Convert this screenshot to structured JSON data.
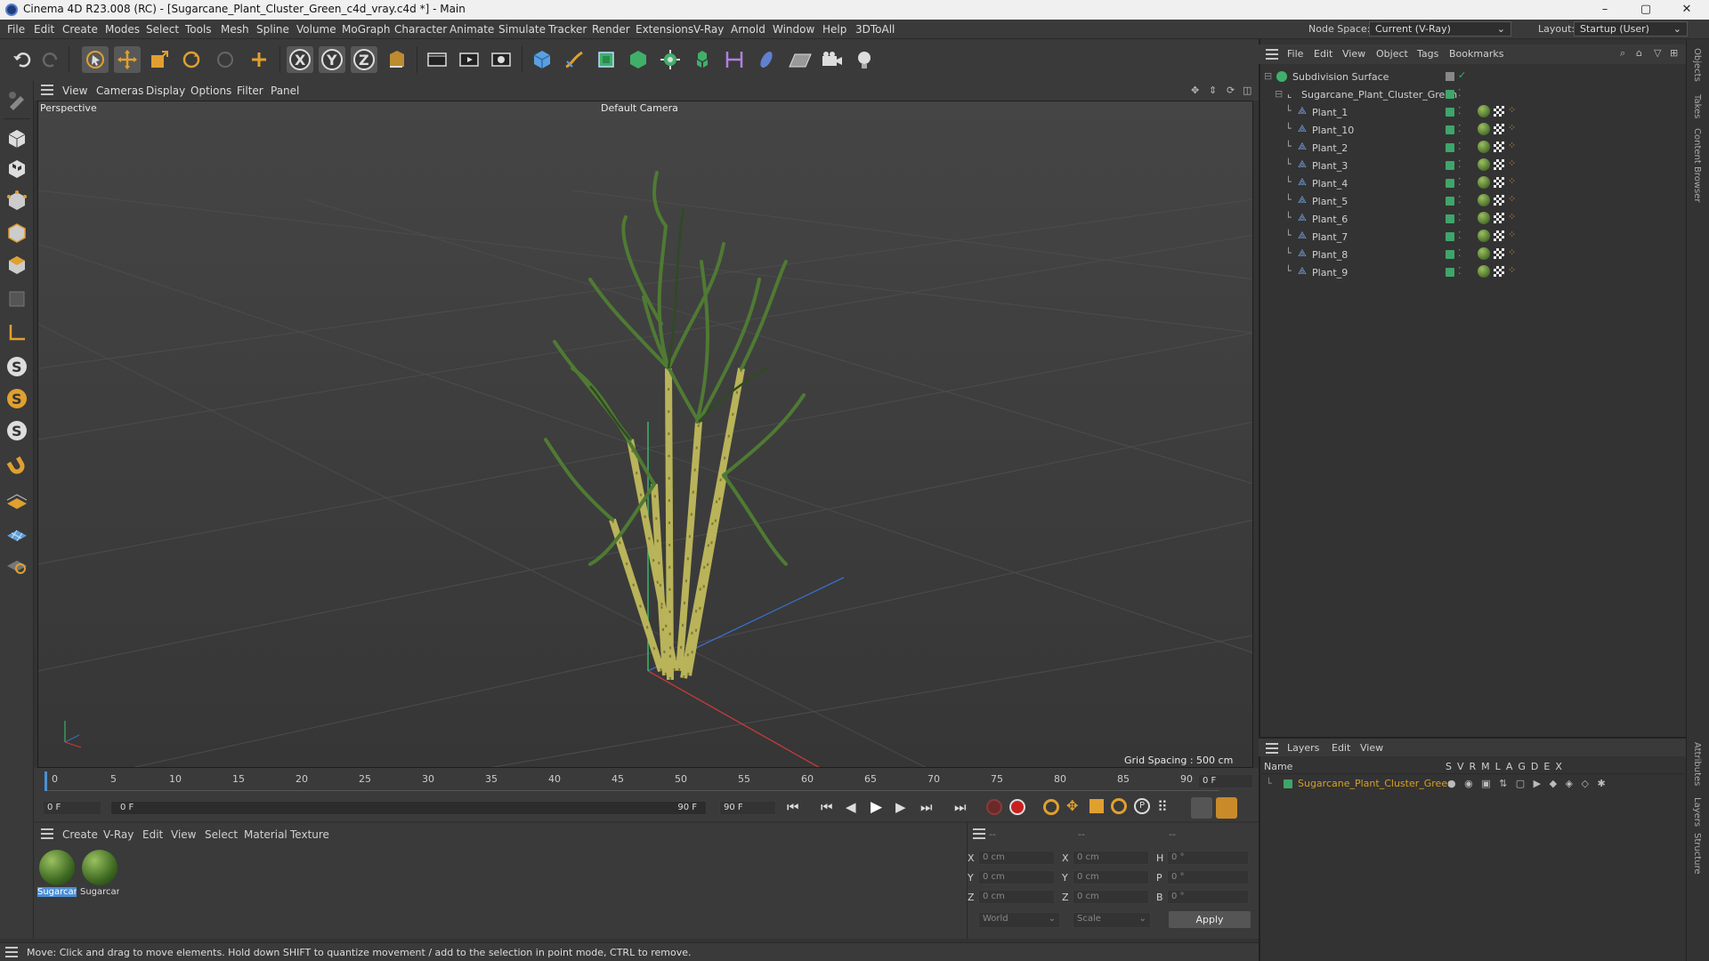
{
  "window": {
    "title": "Cinema 4D R23.008 (RC) - [Sugarcane_Plant_Cluster_Green_c4d_vray.c4d *] - Main",
    "minimize": "–",
    "maximize": "▢",
    "close": "✕"
  },
  "menubar": {
    "items": [
      "File",
      "Edit",
      "Create",
      "Modes",
      "Select",
      "Tools",
      "Mesh",
      "Spline",
      "Volume",
      "MoGraph",
      "Character",
      "Animate",
      "Simulate",
      "Tracker",
      "Render",
      "Extensions",
      "V-Ray",
      "Arnold",
      "Window",
      "Help",
      "3DToAll"
    ],
    "node_space_label": "Node Space:",
    "node_space_value": "Current (V-Ray)",
    "layout_label": "Layout:",
    "layout_value": "Startup (User)"
  },
  "viewport_menu": {
    "items": [
      "View",
      "Cameras",
      "Display",
      "Options",
      "Filter",
      "Panel"
    ],
    "view_name": "Perspective",
    "camera": "Default Camera",
    "grid_spacing": "Grid Spacing : 500 cm"
  },
  "timeline": {
    "ticks": [
      "0",
      "5",
      "10",
      "15",
      "20",
      "25",
      "30",
      "35",
      "40",
      "45",
      "50",
      "55",
      "60",
      "65",
      "70",
      "75",
      "80",
      "85",
      "90"
    ],
    "current_frame": "0 F",
    "start_frame": "0 F",
    "range_start": "0 F",
    "range_end": "90 F",
    "end_frame": "90 F"
  },
  "materials": {
    "menu": [
      "Create",
      "V-Ray",
      "Edit",
      "View",
      "Select",
      "Material",
      "Texture"
    ],
    "items": [
      "Sugarcar",
      "Sugarcar"
    ]
  },
  "coordinates": {
    "header": [
      "--",
      "--",
      "--"
    ],
    "rows": [
      {
        "a": "X",
        "av": "0 cm",
        "b": "X",
        "bv": "0 cm",
        "c": "H",
        "cv": "0 °"
      },
      {
        "a": "Y",
        "av": "0 cm",
        "b": "Y",
        "bv": "0 cm",
        "c": "P",
        "cv": "0 °"
      },
      {
        "a": "Z",
        "av": "0 cm",
        "b": "Z",
        "bv": "0 cm",
        "c": "B",
        "cv": "0 °"
      }
    ],
    "space": "World",
    "mode": "Scale",
    "apply": "Apply"
  },
  "objects": {
    "menu": [
      "File",
      "Edit",
      "View",
      "Object",
      "Tags",
      "Bookmarks"
    ],
    "root": "Subdivision Surface",
    "group": "Sugarcane_Plant_Cluster_Green",
    "children": [
      "Plant_1",
      "Plant_10",
      "Plant_2",
      "Plant_3",
      "Plant_4",
      "Plant_5",
      "Plant_6",
      "Plant_7",
      "Plant_8",
      "Plant_9"
    ]
  },
  "layers": {
    "menu": [
      "Layers",
      "Edit",
      "View"
    ],
    "col_name": "Name",
    "flags": [
      "S",
      "V",
      "R",
      "M",
      "L",
      "A",
      "G",
      "D",
      "E",
      "X"
    ],
    "layer_name": "Sugarcane_Plant_Cluster_Green",
    "layer_color": "#d9a020"
  },
  "side_tabs": [
    "Objects",
    "Takes",
    "Content Browser",
    "Attributes",
    "Layers",
    "Structure"
  ],
  "status": "Move: Click and drag to move elements. Hold down SHIFT to quantize movement / add to the selection in point mode, CTRL to remove.",
  "colors": {
    "accent": "#4c8fd6",
    "green": "#3fa56a",
    "orange": "#e8962c"
  }
}
